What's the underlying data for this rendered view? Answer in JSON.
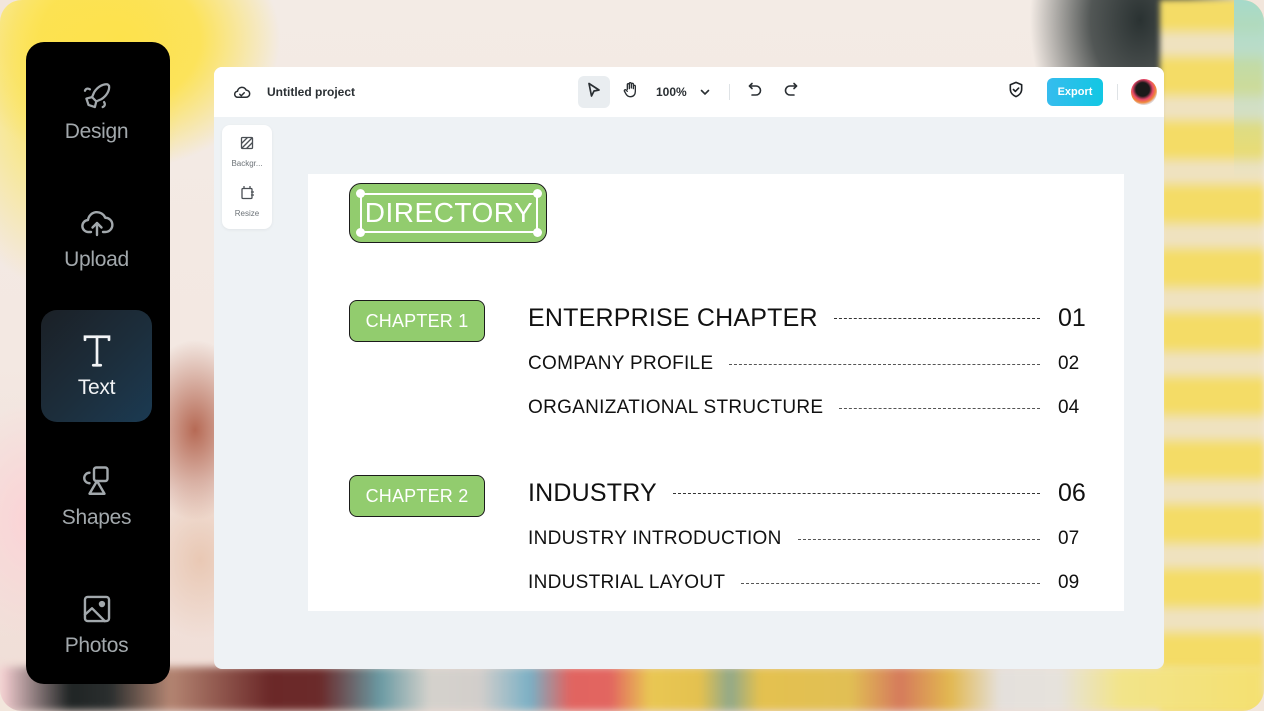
{
  "rail": {
    "items": [
      {
        "id": "design",
        "label": "Design",
        "icon": "rocket-icon",
        "active": false
      },
      {
        "id": "upload",
        "label": "Upload",
        "icon": "cloud-upload-icon",
        "active": false
      },
      {
        "id": "text",
        "label": "Text",
        "icon": "text-icon",
        "active": true
      },
      {
        "id": "shapes",
        "label": "Shapes",
        "icon": "shapes-icon",
        "active": false
      },
      {
        "id": "photos",
        "label": "Photos",
        "icon": "image-icon",
        "active": false
      }
    ]
  },
  "topbar": {
    "cloud_icon": "cloud-sync-icon",
    "project_title": "Untitled project",
    "select_tool_icon": "pointer-icon",
    "hand_tool_icon": "hand-icon",
    "zoom_level": "100%",
    "zoom_dropdown_icon": "chevron-down-icon",
    "undo_icon": "undo-icon",
    "redo_icon": "redo-icon",
    "shield_icon": "shield-check-icon",
    "export_label": "Export",
    "avatar": "user-avatar"
  },
  "side_tools": [
    {
      "label": "Backgr...",
      "icon": "background-icon"
    },
    {
      "label": "Resize",
      "icon": "resize-icon"
    }
  ],
  "canvas": {
    "title": "DIRECTORY",
    "accent_color": "#92cc6e",
    "chapters": [
      {
        "badge": "CHAPTER 1",
        "heading": {
          "label": "ENTERPRISE CHAPTER",
          "page": "01"
        },
        "entries": [
          {
            "label": "COMPANY PROFILE",
            "page": "02"
          },
          {
            "label": "ORGANIZATIONAL STRUCTURE",
            "page": "04"
          }
        ]
      },
      {
        "badge": "CHAPTER 2",
        "heading": {
          "label": "INDUSTRY",
          "page": "06"
        },
        "entries": [
          {
            "label": "INDUSTRY INTRODUCTION",
            "page": "07"
          },
          {
            "label": "INDUSTRIAL LAYOUT",
            "page": "09"
          }
        ]
      }
    ]
  },
  "colors": {
    "export_button": "#12c7e3",
    "rail_active": "#1c2e3c",
    "canvas_bg": "#eef2f5"
  }
}
